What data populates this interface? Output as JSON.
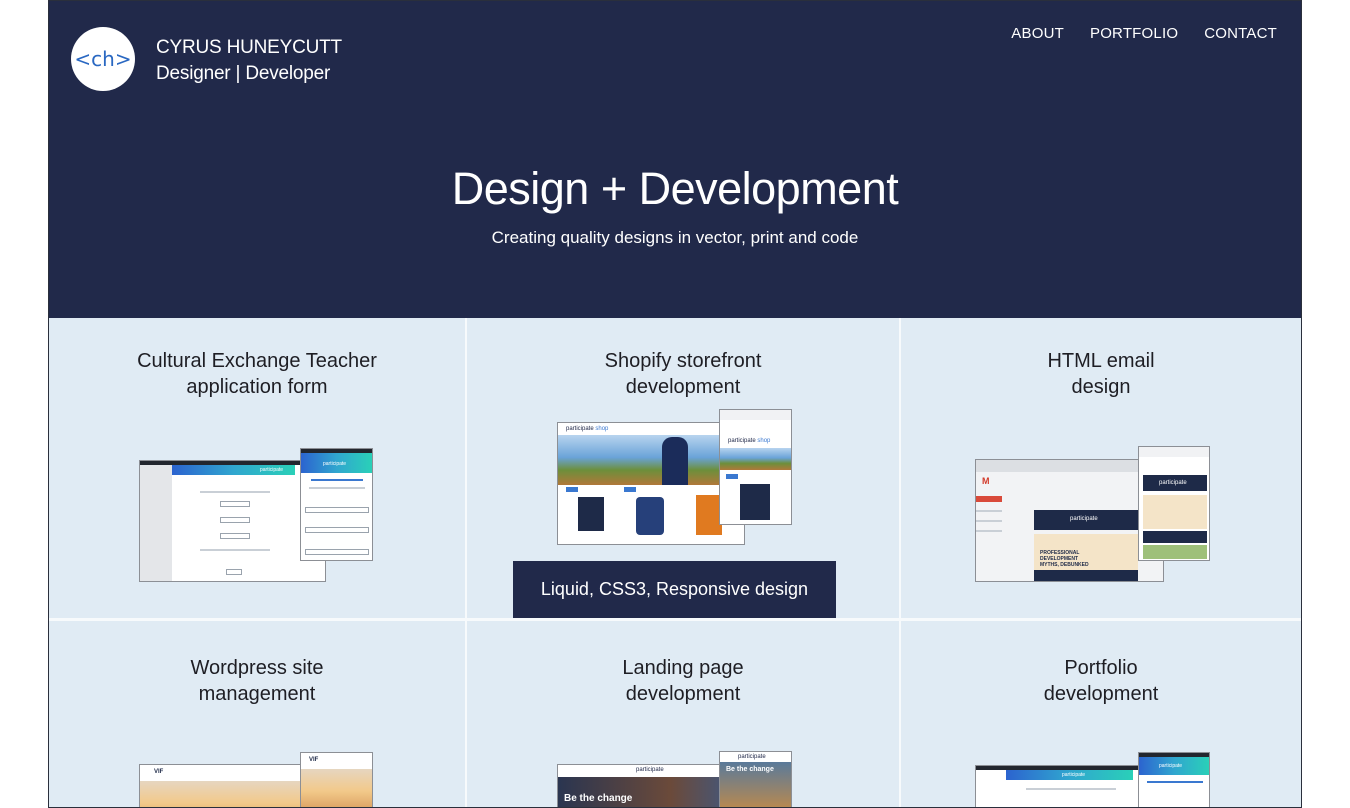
{
  "site": {
    "logo_text": "<ch>",
    "name": "CYRUS HUNEYCUTT",
    "role": "Designer | Developer"
  },
  "nav": [
    "ABOUT",
    "PORTFOLIO",
    "CONTACT"
  ],
  "hero": {
    "title": "Design + Development",
    "subtitle": "Creating quality designs in vector, print and code"
  },
  "cards": [
    {
      "line1": "Cultural Exchange Teacher",
      "line2": "application form"
    },
    {
      "line1": "Shopify storefront",
      "line2": "development"
    },
    {
      "line1": "HTML email",
      "line2": "design"
    },
    {
      "line1": "Wordpress site",
      "line2": "management"
    },
    {
      "line1": "Landing page",
      "line2": "development"
    },
    {
      "line1": "Portfolio",
      "line2": "development"
    }
  ],
  "hover_tag": "Liquid, CSS3, Responsive design",
  "thumbs": {
    "brand": "participate",
    "shop": "shop",
    "email_headline": "PROFESSIONAL DEVELOPMENT MYTHS, DEBUNKED",
    "landing_banner": "Be the change",
    "vif": "VIF",
    "gmail": "M"
  },
  "colors": {
    "header_bg": "#21294a",
    "card_bg": "#e0ebf4",
    "accent_blue": "#2a68c2"
  }
}
